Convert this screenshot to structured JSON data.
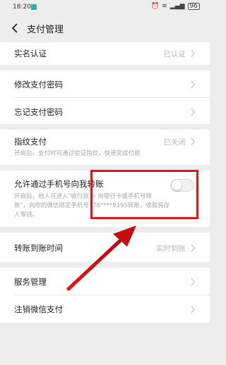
{
  "status_bar": {
    "time": "18:20",
    "battery": "96"
  },
  "header": {
    "title": "支付管理"
  },
  "rows": {
    "realname": {
      "title": "实名认证",
      "value": "已认证"
    },
    "change_pwd": {
      "title": "修改支付密码"
    },
    "forget_pwd": {
      "title": "忘记支付密码"
    },
    "fingerprint": {
      "title": "指纹支付",
      "value": "已关闭",
      "desc": "开启后，支付时可通过验证指纹，快速完成付款"
    },
    "phone_transfer": {
      "title": "允许通过手机号向我转账",
      "desc": [
        "开启后，他人可进入\"收付款 > 向银行卡或手机号转",
        "账\"，向你的微信绑定手机号176****9195转账，收款将存",
        "入零钱。"
      ],
      "toggle_on": false
    },
    "arrival_time": {
      "title": "转账到账时间",
      "value": "实时到账"
    },
    "service_mgmt": {
      "title": "服务管理"
    },
    "cancel_pay": {
      "title": "注销微信支付"
    }
  },
  "annotation_color": "#e4141b"
}
